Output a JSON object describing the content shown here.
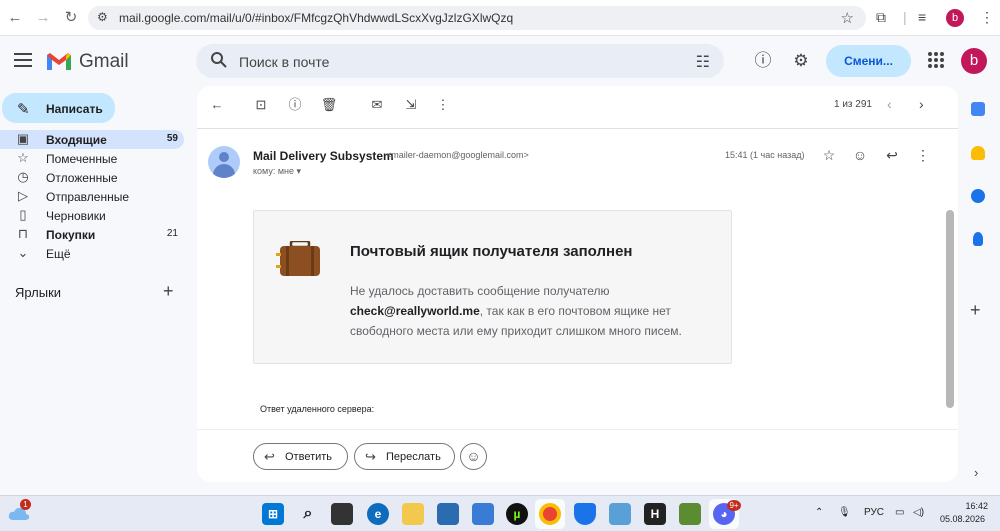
{
  "browser": {
    "url": "mail.google.com/mail/u/0/#inbox/FMfcgzQhVhdwwdLScxXvgJzlzGXlwQzq",
    "profile_initial": "b"
  },
  "header": {
    "logo_text": "Gmail",
    "search_placeholder": "Поиск в почте",
    "switch_label": "Смени...",
    "avatar_initial": "b"
  },
  "sidebar": {
    "compose_label": "Написать",
    "items": [
      {
        "label": "Входящие",
        "count": "59"
      },
      {
        "label": "Помеченные",
        "count": ""
      },
      {
        "label": "Отложенные",
        "count": ""
      },
      {
        "label": "Отправленные",
        "count": ""
      },
      {
        "label": "Черновики",
        "count": ""
      },
      {
        "label": "Покупки",
        "count": "21"
      },
      {
        "label": "Ещё",
        "count": ""
      }
    ],
    "labels_heading": "Ярлыки"
  },
  "toolbar": {
    "pager_text": "1 из 291"
  },
  "message": {
    "sender_name": "Mail Delivery Subsystem",
    "sender_address": "<mailer-daemon@googlemail.com>",
    "to_line": "кому: мне",
    "time": "15:41 (1 час назад)",
    "card_title": "Почтовый ящик получателя заполнен",
    "card_text_1": "Не удалось доставить сообщение получателю",
    "card_email": "check@reallyworld.me",
    "card_text_2": ", так как в его почтовом ящике нет свободного места или ему приходит слишком много писем.",
    "remote_server_label": "Ответ удаленного сервера:",
    "reply_label": "Ответить",
    "forward_label": "Переслать"
  },
  "taskbar": {
    "weather_badge": "1",
    "language": "РУС",
    "time": "16:42",
    "date": "05.08.2026",
    "discord_badge": "9+"
  },
  "colors": {
    "accent": "#0b57d0",
    "compose_bg": "#c2e7ff",
    "active_nav": "#d3e3fd",
    "avatar": "#c2185b"
  }
}
